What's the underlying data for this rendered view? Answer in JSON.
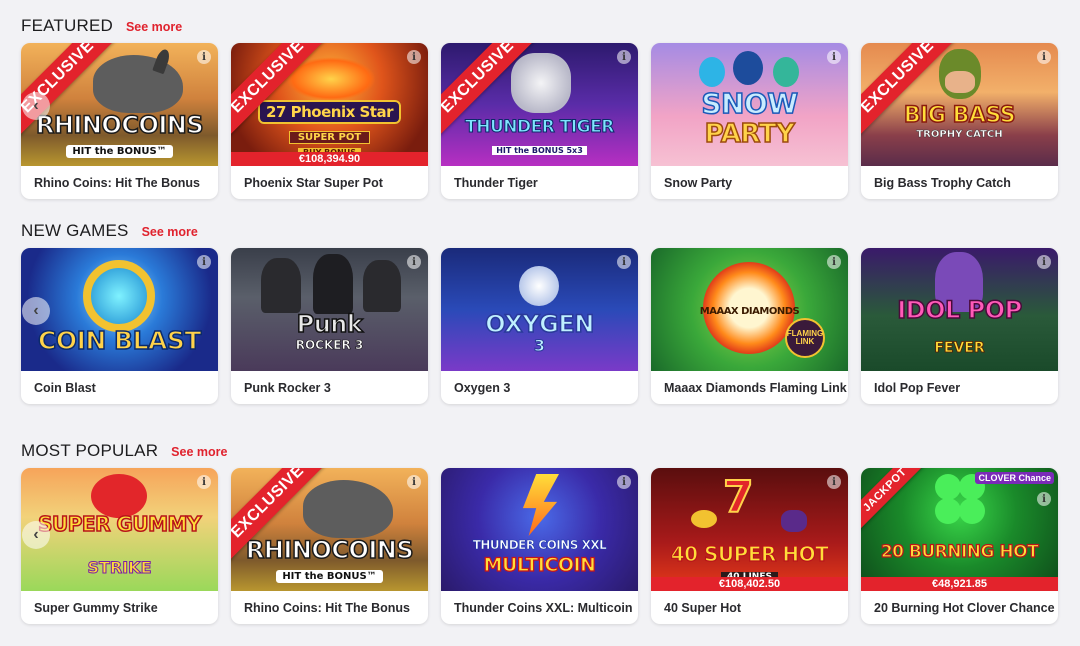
{
  "sections": [
    {
      "title": "FEATURED",
      "see_more": "See more",
      "games": [
        {
          "name": "Rhino Coins: Hit The Bonus",
          "logo": "RHINOCOINS",
          "sub": "HIT the BONUS™",
          "ribbon": "EXCLUSIVE",
          "jackpot": ""
        },
        {
          "name": "Phoenix Star Super Pot",
          "logo": "27 Phoenix Star",
          "sub": "SUPER POT",
          "sub2": "BUY BONUS",
          "ribbon": "EXCLUSIVE",
          "jackpot": "€108,394.90"
        },
        {
          "name": "Thunder Tiger",
          "logo": "THUNDER TIGER",
          "sub": "HIT the BONUS 5x3",
          "ribbon": "EXCLUSIVE",
          "jackpot": ""
        },
        {
          "name": "Snow Party",
          "logo": "SNOW",
          "sub": "PARTY",
          "ribbon": "",
          "jackpot": ""
        },
        {
          "name": "Big Bass Trophy Catch",
          "logo": "BIG BASS",
          "sub": "TROPHY CATCH",
          "ribbon": "EXCLUSIVE",
          "jackpot": ""
        }
      ]
    },
    {
      "title": "NEW GAMES",
      "see_more": "See more",
      "games": [
        {
          "name": "Coin Blast",
          "logo": "COIN BLAST",
          "sub": "",
          "ribbon": "",
          "jackpot": ""
        },
        {
          "name": "Punk Rocker 3",
          "logo": "Punk",
          "sub": "ROCKER 3",
          "ribbon": "",
          "jackpot": ""
        },
        {
          "name": "Oxygen 3",
          "logo": "OXYGEN",
          "sub": "3",
          "ribbon": "",
          "jackpot": ""
        },
        {
          "name": "Maaax Diamonds Flaming Link",
          "logo": "MAAAX DIAMONDS",
          "sub": "FLAMING LINK",
          "ribbon": "",
          "jackpot": ""
        },
        {
          "name": "Idol Pop Fever",
          "logo": "IDOL POP",
          "sub": "FEVER",
          "ribbon": "",
          "jackpot": ""
        }
      ]
    },
    {
      "title": "MOST POPULAR",
      "see_more": "See more",
      "games": [
        {
          "name": "Super Gummy Strike",
          "logo": "SUPER GUMMY",
          "sub": "STRIKE",
          "ribbon": "",
          "jackpot": ""
        },
        {
          "name": "Rhino Coins: Hit The Bonus",
          "logo": "RHINOCOINS",
          "sub": "HIT the BONUS™",
          "ribbon": "EXCLUSIVE",
          "jackpot": ""
        },
        {
          "name": "Thunder Coins XXL: Multicoin",
          "logo": "THUNDER COINS XXL",
          "sub": "MULTICOIN",
          "ribbon": "",
          "jackpot": ""
        },
        {
          "name": "40 Super Hot",
          "logo": "40 SUPER HOT",
          "sub": "40 LINES",
          "ribbon": "",
          "jackpot": "€108,402.50"
        },
        {
          "name": "20 Burning Hot Clover Chance",
          "logo": "20 BURNING HOT",
          "sub": "CLOVER Chance",
          "ribbon": "JACKPOT",
          "jackpot": "€48,921.85"
        }
      ]
    }
  ],
  "icons": {
    "info": "i",
    "carousel_prev": "‹"
  },
  "colors": {
    "accent": "#e0232e",
    "ribbon": "#e3232c",
    "background": "#f2f2f5"
  }
}
